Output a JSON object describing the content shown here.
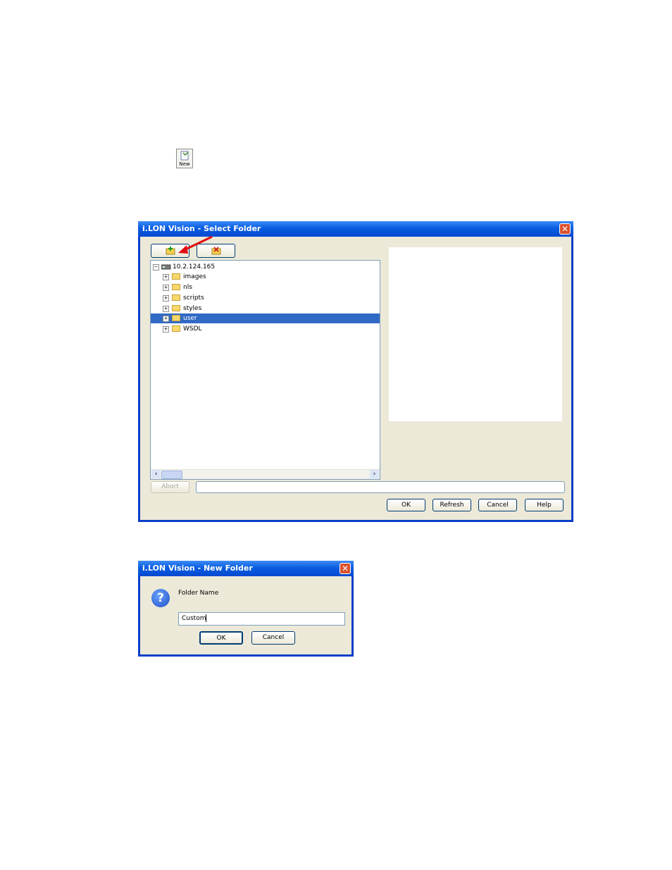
{
  "toolbar_icon": {
    "label": "New",
    "icon": "new-document-icon"
  },
  "select_folder": {
    "title": "i.LON Vision - Select Folder",
    "new_folder_icon": "new-folder-icon",
    "delete_folder_icon": "delete-folder-icon",
    "tree": {
      "root": "10.2.124.165",
      "items": [
        {
          "label": "images",
          "selected": false
        },
        {
          "label": "nls",
          "selected": false
        },
        {
          "label": "scripts",
          "selected": false
        },
        {
          "label": "styles",
          "selected": false
        },
        {
          "label": "user",
          "selected": true
        },
        {
          "label": "WSDL",
          "selected": false
        }
      ]
    },
    "abort_label": "Abort",
    "status_value": "",
    "buttons": {
      "ok": "OK",
      "refresh": "Refresh",
      "cancel": "Cancel",
      "help": "Help"
    }
  },
  "new_folder": {
    "title": "i.LON Vision - New Folder",
    "prompt": "Folder Name",
    "value": "Custom",
    "buttons": {
      "ok": "OK",
      "cancel": "Cancel"
    }
  },
  "colors": {
    "titlebar": "#0a5de0",
    "selection": "#316ac5",
    "close": "#d9532d",
    "arrow": "#e01010"
  }
}
